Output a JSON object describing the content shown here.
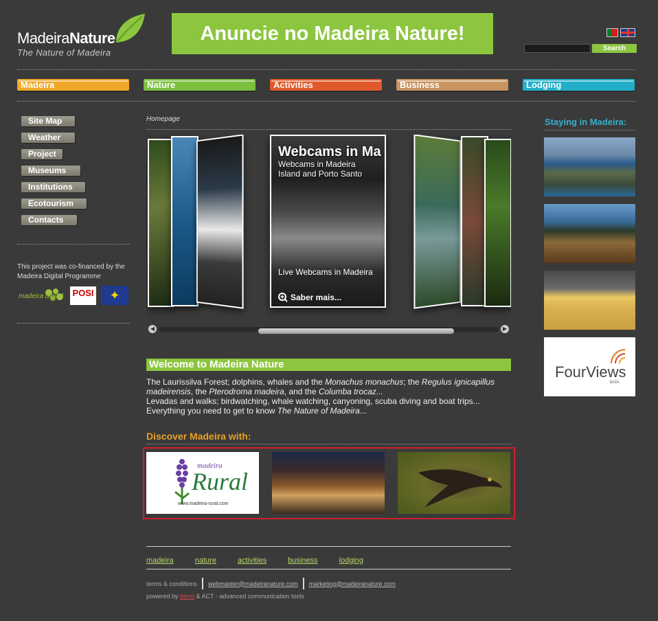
{
  "header": {
    "logo_brand_regular": "Madeira",
    "logo_brand_bold": "Nature",
    "logo_tagline": "The Nature of Madeira",
    "banner_text": "Anuncie no Madeira Nature!",
    "search_placeholder": "",
    "search_button": "Search"
  },
  "top_nav": [
    {
      "label": "Madeira",
      "color": "#f0a828"
    },
    {
      "label": "Nature",
      "color": "#7cbf3e"
    },
    {
      "label": "Activities",
      "color": "#e0592a"
    },
    {
      "label": "Business",
      "color": "#c99460"
    },
    {
      "label": "Lodging",
      "color": "#22aec9"
    }
  ],
  "left_nav": [
    "Site Map",
    "Weather",
    "Project",
    "Museums",
    "Institutions",
    "Ecotourism",
    "Contacts"
  ],
  "cofinance": {
    "text": "This project was co-financed by the Madeira Digital Programme",
    "md_logo_text": "madeira digital",
    "posi_text": "POSI"
  },
  "breadcrumb": "Homepage",
  "carousel": {
    "title": "Webcams in Ma",
    "subtitle_line1": "Webcams in Madeira",
    "subtitle_line2": "Island and Porto Santo",
    "caption": "Live Webcams in Madeira",
    "more": "Saber mais..."
  },
  "welcome": {
    "title": "Welcome to Madeira Nature",
    "p1_a": "The Laurissilva Forest; dolphins, whales and the ",
    "p1_b": "Monachus monachus",
    "p1_c": "; the ",
    "p1_d": "Regulus ignicapillus madeirensis",
    "p1_e": ", the ",
    "p1_f": "Pterodroma madeira",
    "p1_g": ", and the ",
    "p1_h": "Columba trocaz...",
    "p2": "Levadas and walks; birdwatching, whale watching, canyoning, scuba diving and boat trips...",
    "p3_a": "Everything you need to get to know ",
    "p3_b": "The Nature of Madeira",
    "p3_c": "..."
  },
  "discover": {
    "title": "Discover Madeira with:",
    "rural_small": "madeira",
    "rural_big": "Rural",
    "rural_url": "www.madeira-rural.com"
  },
  "right": {
    "title": "Staying in Madeira:",
    "fourviews_a": "Four",
    "fourviews_b": "Views",
    "fourviews_sub": "BAÍA"
  },
  "footer": {
    "links": [
      "madeira",
      "nature",
      "activities",
      "business",
      "lodging"
    ],
    "terms": "terms & conditions",
    "email1": "webmaster@madeiranature.com",
    "email2": "marketing@madeiranature.com",
    "powered_a": "powered by ",
    "powered_b": "berro",
    "powered_c": " & ACT - advanced communication tools"
  }
}
